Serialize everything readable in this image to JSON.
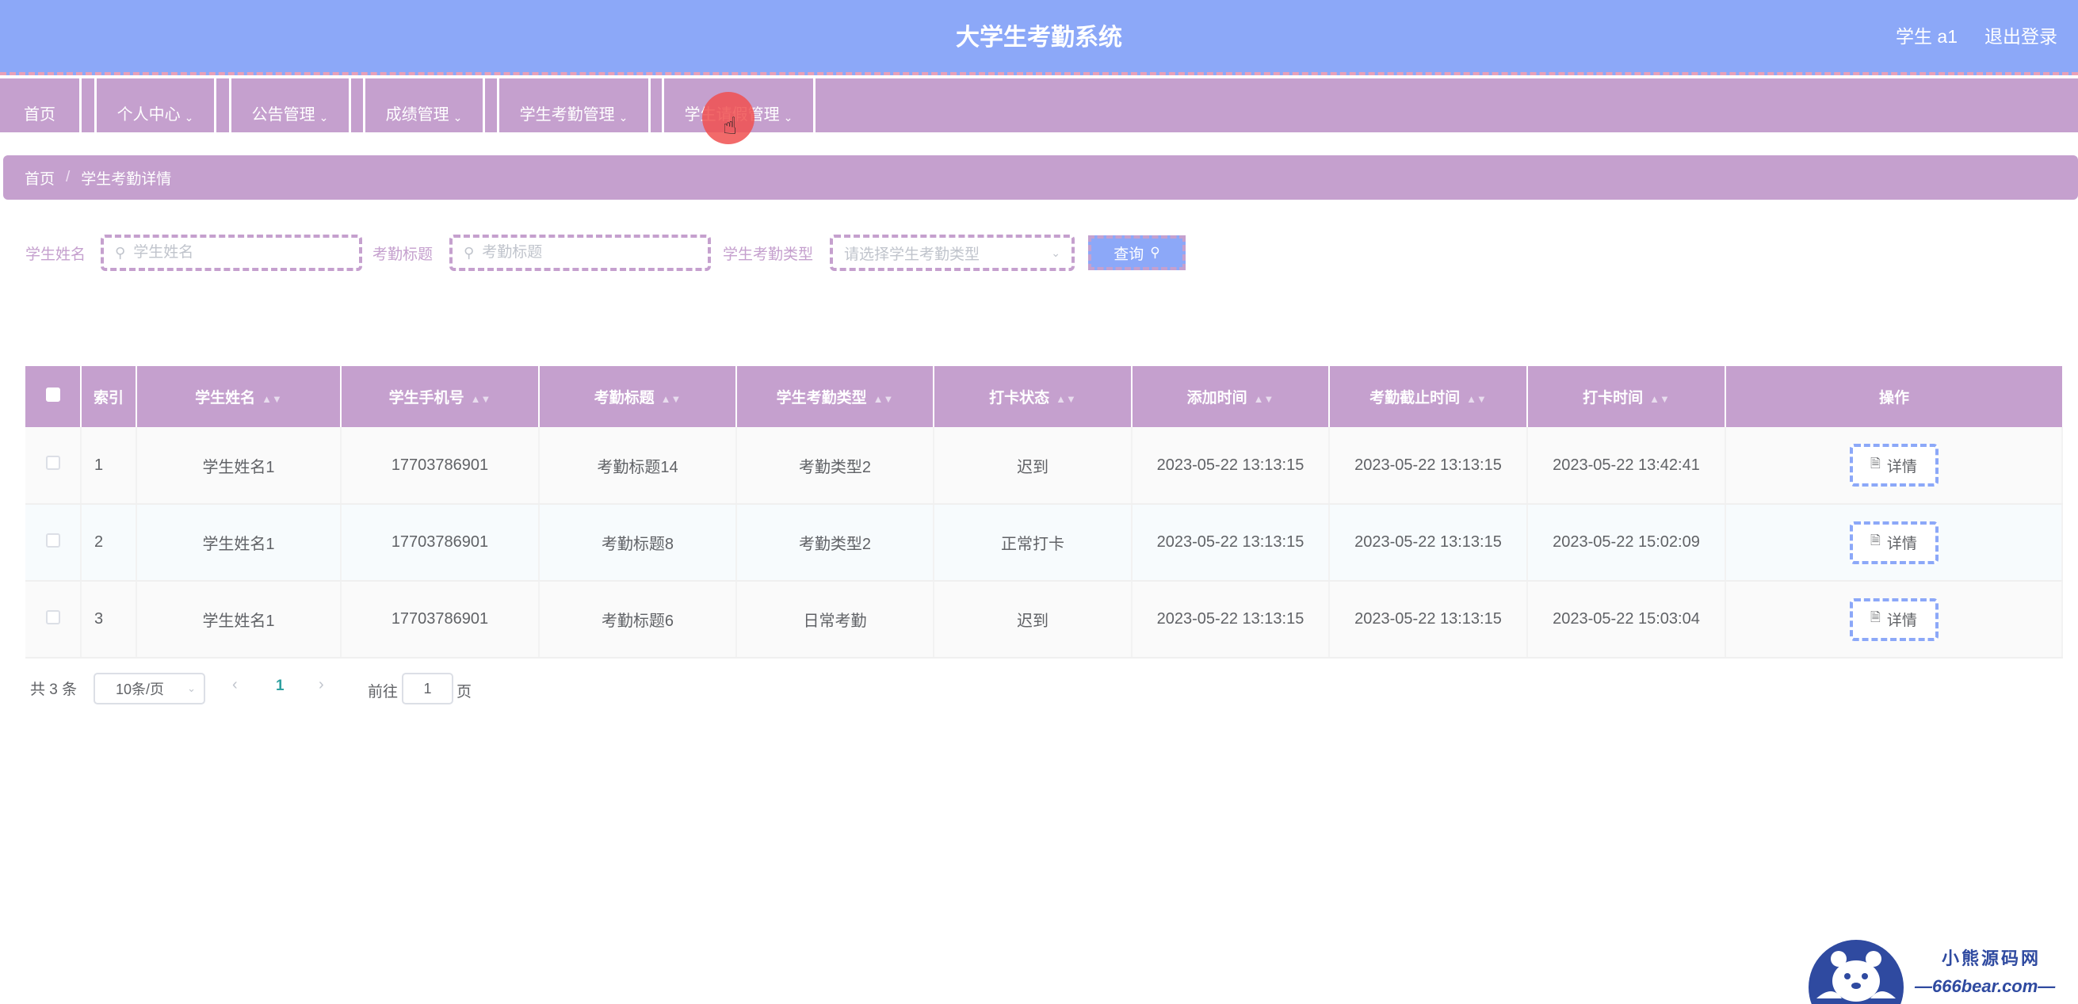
{
  "header": {
    "title": "大学生考勤系统",
    "user": "学生 a1",
    "logout": "退出登录"
  },
  "nav": {
    "items": [
      {
        "label": "首页",
        "has_dropdown": false
      },
      {
        "label": "个人中心",
        "has_dropdown": true
      },
      {
        "label": "公告管理",
        "has_dropdown": true
      },
      {
        "label": "成绩管理",
        "has_dropdown": true
      },
      {
        "label": "学生考勤管理",
        "has_dropdown": true
      },
      {
        "label": "学生请假管理",
        "has_dropdown": true
      }
    ]
  },
  "breadcrumb": {
    "home": "首页",
    "separator": "/",
    "current": "学生考勤详情"
  },
  "search": {
    "name_label": "学生姓名",
    "name_placeholder": "学生姓名",
    "title_label": "考勤标题",
    "title_placeholder": "考勤标题",
    "type_label": "学生考勤类型",
    "type_placeholder": "请选择学生考勤类型",
    "query_button": "查询"
  },
  "table": {
    "columns": [
      "索引",
      "学生姓名",
      "学生手机号",
      "考勤标题",
      "学生考勤类型",
      "打卡状态",
      "添加时间",
      "考勤截止时间",
      "打卡时间",
      "操作"
    ],
    "detail_label": "详情",
    "rows": [
      {
        "index": "1",
        "name": "学生姓名1",
        "phone": "17703786901",
        "title": "考勤标题14",
        "type": "考勤类型2",
        "status": "迟到",
        "added": "2023-05-22 13:13:15",
        "deadline": "2023-05-22 13:13:15",
        "clock": "2023-05-22 13:42:41"
      },
      {
        "index": "2",
        "name": "学生姓名1",
        "phone": "17703786901",
        "title": "考勤标题8",
        "type": "考勤类型2",
        "status": "正常打卡",
        "added": "2023-05-22 13:13:15",
        "deadline": "2023-05-22 13:13:15",
        "clock": "2023-05-22 15:02:09"
      },
      {
        "index": "3",
        "name": "学生姓名1",
        "phone": "17703786901",
        "title": "考勤标题6",
        "type": "日常考勤",
        "status": "迟到",
        "added": "2023-05-22 13:13:15",
        "deadline": "2023-05-22 13:13:15",
        "clock": "2023-05-22 15:03:04"
      }
    ]
  },
  "pagination": {
    "total": "共 3 条",
    "page_size": "10条/页",
    "current_page": "1",
    "goto_label": "前往",
    "goto_value": "1",
    "page_suffix": "页"
  },
  "watermark": {
    "line1": "小熊源码网",
    "line2": "—666bear.com—"
  },
  "colors": {
    "header_bg": "#8ca8f8",
    "accent_purple": "#c5a0ce",
    "dash_pink": "#e8a0b8",
    "pager_active": "#2fa0a0"
  },
  "icons": {
    "search": "search-icon",
    "chevron": "chevron-down-icon",
    "sort": "sort-icon",
    "document": "document-icon",
    "pointer": "hand-pointer-icon"
  }
}
